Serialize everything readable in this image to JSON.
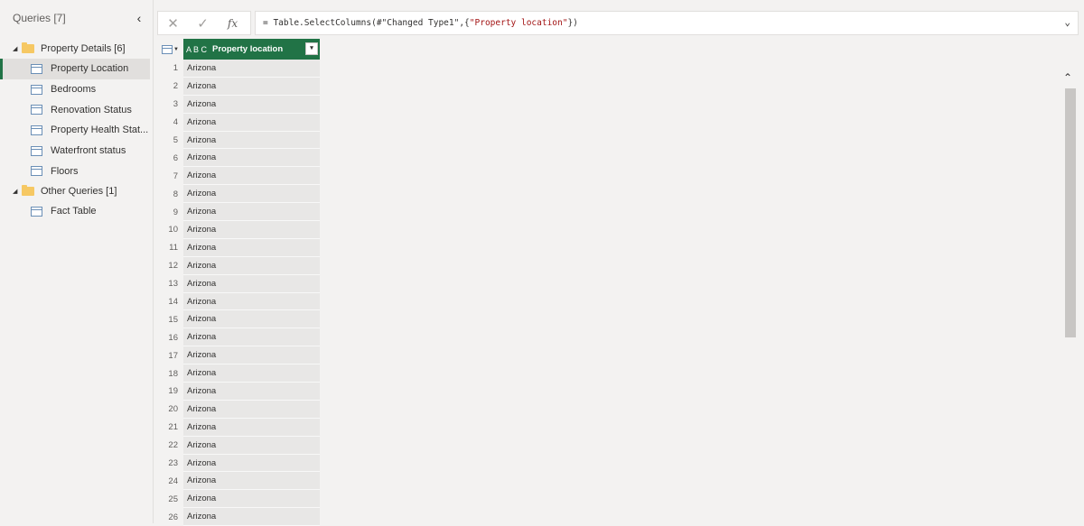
{
  "queries_pane": {
    "title": "Queries [7]",
    "collapse_glyph": "‹",
    "groups": [
      {
        "label": "Property Details [6]",
        "items": [
          {
            "label": "Property Location",
            "selected": true
          },
          {
            "label": "Bedrooms"
          },
          {
            "label": "Renovation Status"
          },
          {
            "label": "Property Health Stat..."
          },
          {
            "label": "Waterfront status"
          },
          {
            "label": "Floors"
          }
        ]
      },
      {
        "label": "Other Queries [1]",
        "items": [
          {
            "label": "Fact Table"
          }
        ]
      }
    ]
  },
  "formula_bar": {
    "cancel_glyph": "✕",
    "confirm_glyph": "✓",
    "fx_label": "fx",
    "formula_prefix": "= Table.SelectColumns(#\"Changed Type1\",{",
    "formula_string": "\"Property location\"",
    "formula_suffix": "})",
    "expand_glyph": "⌄"
  },
  "grid": {
    "column_type_icon": "A B C",
    "column_header": "Property location",
    "filter_glyph": "▾",
    "rows": [
      {
        "n": "1",
        "value": "Arizona"
      },
      {
        "n": "2",
        "value": "Arizona"
      },
      {
        "n": "3",
        "value": "Arizona"
      },
      {
        "n": "4",
        "value": "Arizona"
      },
      {
        "n": "5",
        "value": "Arizona"
      },
      {
        "n": "6",
        "value": "Arizona"
      },
      {
        "n": "7",
        "value": "Arizona"
      },
      {
        "n": "8",
        "value": "Arizona"
      },
      {
        "n": "9",
        "value": "Arizona"
      },
      {
        "n": "10",
        "value": "Arizona"
      },
      {
        "n": "11",
        "value": "Arizona"
      },
      {
        "n": "12",
        "value": "Arizona"
      },
      {
        "n": "13",
        "value": "Arizona"
      },
      {
        "n": "14",
        "value": "Arizona"
      },
      {
        "n": "15",
        "value": "Arizona"
      },
      {
        "n": "16",
        "value": "Arizona"
      },
      {
        "n": "17",
        "value": "Arizona"
      },
      {
        "n": "18",
        "value": "Arizona"
      },
      {
        "n": "19",
        "value": "Arizona"
      },
      {
        "n": "20",
        "value": "Arizona"
      },
      {
        "n": "21",
        "value": "Arizona"
      },
      {
        "n": "22",
        "value": "Arizona"
      },
      {
        "n": "23",
        "value": "Arizona"
      },
      {
        "n": "24",
        "value": "Arizona"
      },
      {
        "n": "25",
        "value": "Arizona"
      },
      {
        "n": "26",
        "value": "Arizona"
      }
    ]
  },
  "scrollbar": {
    "up_glyph": "⌃"
  },
  "colors": {
    "accent": "#217346",
    "folder": "#f6c863",
    "background": "#f3f2f1"
  }
}
